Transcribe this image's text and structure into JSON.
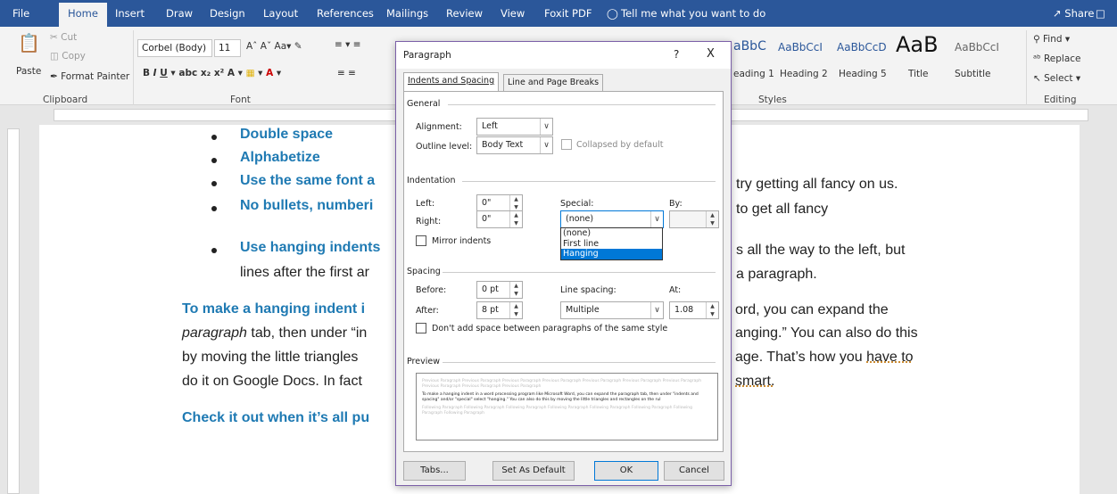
{
  "tabs": [
    "File",
    "Home",
    "Insert",
    "Draw",
    "Design",
    "Layout",
    "References",
    "Mailings",
    "Review",
    "View",
    "Foxit PDF"
  ],
  "tell_me": "Tell me what you want to do",
  "share": "Share",
  "clipboard": {
    "cut": "Cut",
    "copy": "Copy",
    "paste": "Paste",
    "format_painter": "Format Painter",
    "label": "Clipboard"
  },
  "font": {
    "name": "Corbel (Body)",
    "size": "11",
    "label": "Font"
  },
  "styles": {
    "samples": [
      "aBbC",
      "AaBbCcI",
      "AaBbCcD",
      "AaB",
      "AaBbCcI"
    ],
    "names": [
      "eading 1",
      "Heading 2",
      "Heading 5",
      "Title",
      "Subtitle"
    ],
    "label": "Styles"
  },
  "editing": {
    "find": "Find",
    "replace": "Replace",
    "select": "Select",
    "label": "Editing"
  },
  "doc": {
    "b1": "Double space",
    "b2": "Alphabetize",
    "b3": "Use the same font a",
    "b3r": "try getting all fancy on us.",
    "b4": "No bullets, numberi",
    "b4r": "to get all fancy",
    "b5": "Use hanging indents",
    "b5r": "s all the way to the left, but",
    "b5b": "lines after the first ar",
    "b5br": "a paragraph.",
    "p1a": "To make a hanging indent i",
    "p1r": "ord, you can expand the",
    "p2a": "paragraph",
    "p2b": "tab, then under “in",
    "p2r": "anging.”  You can also do this",
    "p3a": "by moving the little triangles",
    "p3r": "age.  That’s how you ",
    "p3u": "have to",
    "p4a": "do it on Google Docs.  In fact",
    "p4r": "smart.",
    "p5": "Check it out when it’s all pu"
  },
  "dialog": {
    "title": "Paragraph",
    "help": "?",
    "close": "X",
    "tab1": "Indents and Spacing",
    "tab2": "Line and Page Breaks",
    "general": "General",
    "alignment_label": "Alignment:",
    "alignment": "Left",
    "outline_label": "Outline level:",
    "outline": "Body Text",
    "collapsed": "Collapsed by default",
    "indentation": "Indentation",
    "left_label": "Left:",
    "left": "0\"",
    "right_label": "Right:",
    "right": "0\"",
    "special_label": "Special:",
    "special": "(none)",
    "by_label": "By:",
    "special_options": [
      "(none)",
      "First line",
      "Hanging"
    ],
    "mirror": "Mirror indents",
    "spacing": "Spacing",
    "before_label": "Before:",
    "before": "0 pt",
    "after_label": "After:",
    "after": "8 pt",
    "line_spacing_label": "Line spacing:",
    "line_spacing": "Multiple",
    "at_label": "At:",
    "at": "1.08",
    "dont_add": "Don't add space between paragraphs of the same style",
    "preview": "Preview",
    "prev_para": "Previous Paragraph Previous Paragraph Previous Paragraph Previous Paragraph Previous Paragraph Previous Paragraph Previous Paragraph Previous Paragraph Previous Paragraph Previous Paragraph",
    "sample": "To make a hanging indent in a word processing program like Microsoft Word, you can expand the paragraph tab, then under \"indents and spacing\" and/or \"special\" select \"hanging.\" You can also do this by moving the little triangles and rectangles on the rul",
    "follow_para": "Following Paragraph Following Paragraph Following Paragraph Following Paragraph Following Paragraph Following Paragraph Following Paragraph Following Paragraph",
    "tabs_btn": "Tabs...",
    "default_btn": "Set As Default",
    "ok": "OK",
    "cancel": "Cancel"
  }
}
